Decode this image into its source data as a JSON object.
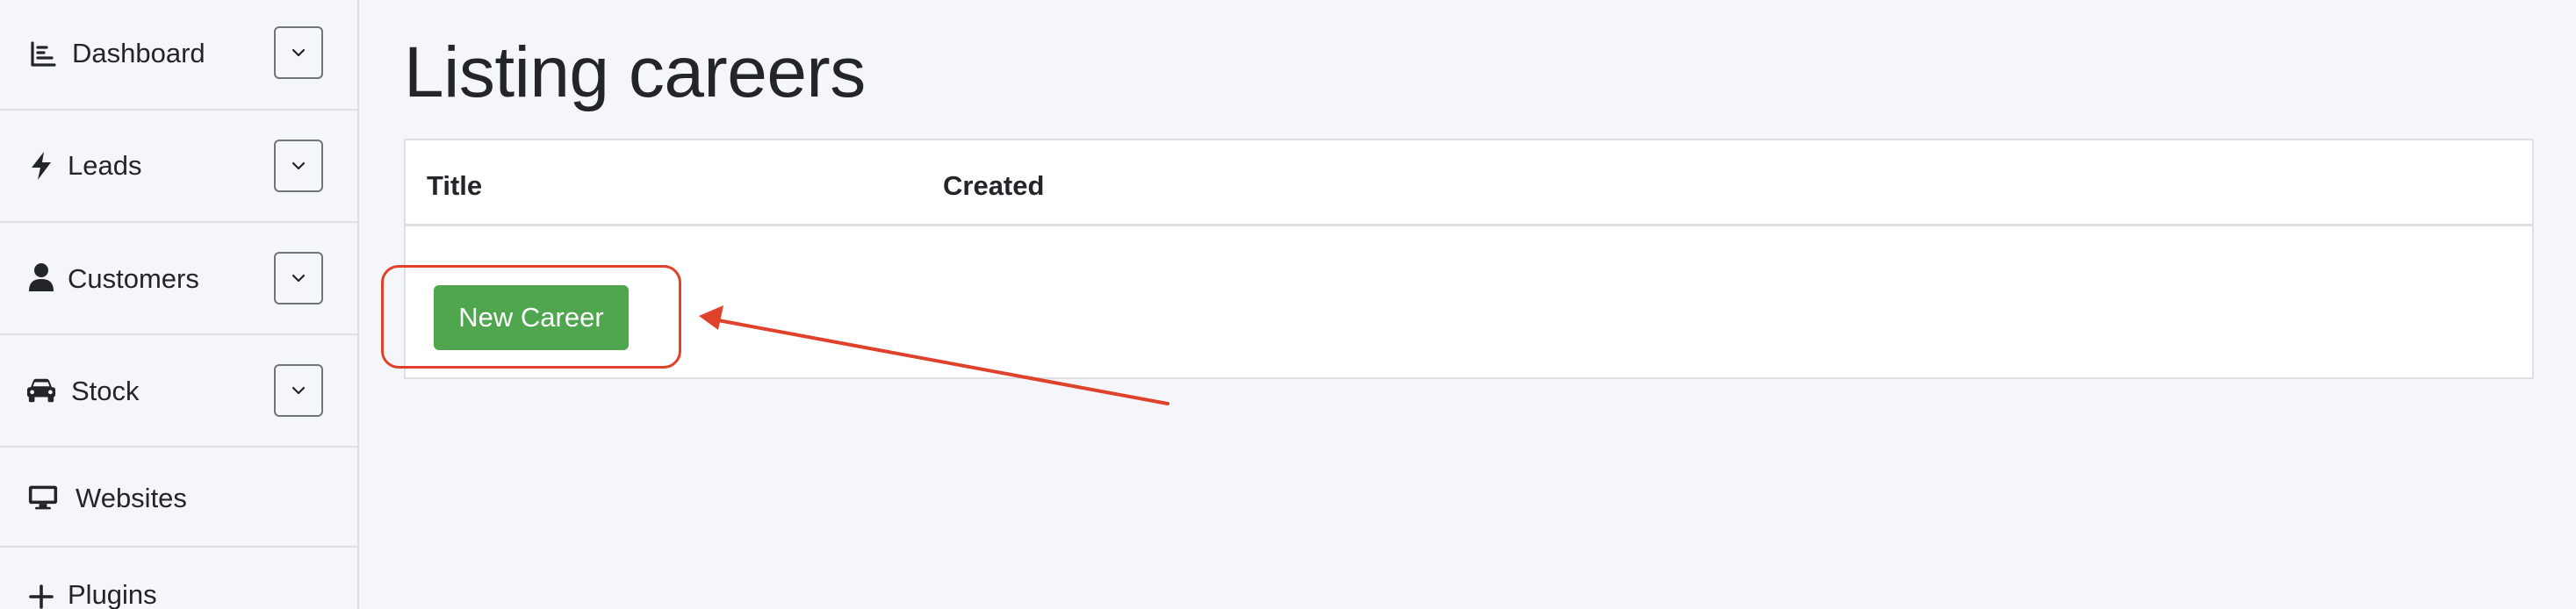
{
  "sidebar": {
    "items": [
      {
        "label": "Dashboard",
        "icon": "bar-chart-icon",
        "has_toggle": true
      },
      {
        "label": "Leads",
        "icon": "lightning-icon",
        "has_toggle": true
      },
      {
        "label": "Customers",
        "icon": "user-icon",
        "has_toggle": true
      },
      {
        "label": "Stock",
        "icon": "car-icon",
        "has_toggle": true
      },
      {
        "label": "Websites",
        "icon": "monitor-icon",
        "has_toggle": false
      },
      {
        "label": "Plugins",
        "icon": "plus-icon",
        "has_toggle": false
      }
    ],
    "toggle_icon": "chevron-down-icon"
  },
  "main": {
    "title": "Listing careers",
    "table": {
      "columns": [
        "Title",
        "Created"
      ],
      "rows": []
    },
    "new_button_label": "New Career"
  },
  "annotation": {
    "color": "#e0412b",
    "type": "highlight-with-arrow"
  },
  "colors": {
    "button_green": "#4fa64f",
    "background": "#f5f6fa",
    "border": "#dcdfe4"
  }
}
